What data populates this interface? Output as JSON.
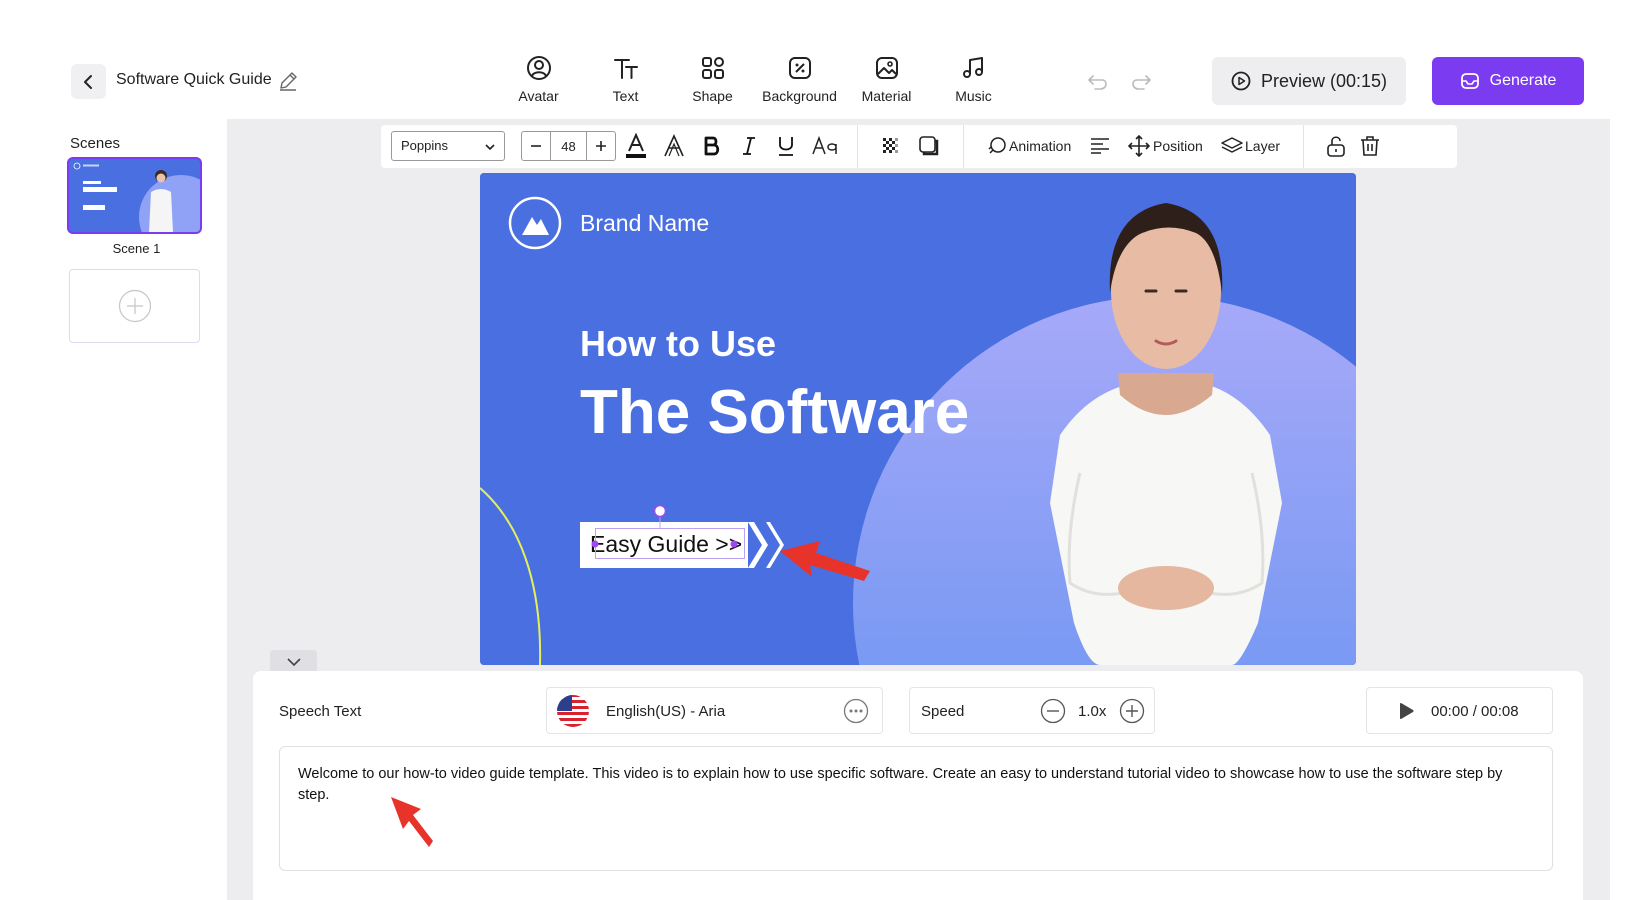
{
  "project": {
    "title": "Software Quick Guide"
  },
  "toolbar": {
    "tools": [
      {
        "label": "Avatar",
        "icon": "avatar-icon"
      },
      {
        "label": "Text",
        "icon": "text-icon"
      },
      {
        "label": "Shape",
        "icon": "shape-icon"
      },
      {
        "label": "Background",
        "icon": "background-icon"
      },
      {
        "label": "Material",
        "icon": "material-icon"
      },
      {
        "label": "Music",
        "icon": "music-icon"
      }
    ],
    "preview_label": "Preview (00:15)",
    "generate_label": "Generate"
  },
  "scenes": {
    "label": "Scenes",
    "items": [
      {
        "name": "Scene 1"
      }
    ]
  },
  "format": {
    "font": "Poppins",
    "size": "48",
    "animation_label": "Animation",
    "position_label": "Position",
    "layer_label": "Layer"
  },
  "slide": {
    "brand": "Brand Name",
    "headline_1": "How to Use",
    "headline_2": "The Software",
    "guide_text": "Easy Guide >>"
  },
  "speech": {
    "label": "Speech Text",
    "voice": "English(US) - Aria",
    "speed_label": "Speed",
    "speed_value": "1.0x",
    "time": "00:00 / 00:08",
    "text": "Welcome to our how-to video guide template. This video is to explain how to use specific software. Create an easy to understand tutorial video to showcase how to use the software step by step."
  },
  "colors": {
    "accent": "#7b3bf0",
    "slide_bg": "#4a6fe0",
    "arrow": "#e8332a"
  }
}
